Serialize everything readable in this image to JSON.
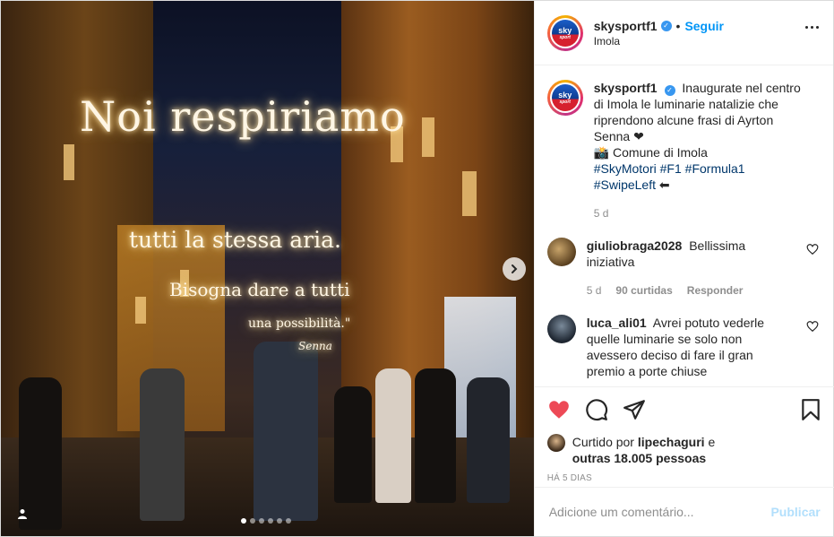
{
  "post": {
    "author": "skysportf1",
    "location": "Imola",
    "follow_label": "Seguir",
    "separator": "•",
    "verified_mark": "✓",
    "logo_text_top": "sky",
    "logo_text_bottom": "sport"
  },
  "photo": {
    "lines": [
      "Noi respiriamo",
      "tutti la stessa aria.",
      "Bisogna dare a tutti",
      "una possibilità.\"",
      "Senna"
    ],
    "carousel_total": 6,
    "carousel_active": 1
  },
  "caption": {
    "author": "skysportf1",
    "text": "Inaugurate nel centro di Imola le luminarie natalizie che riprendono alcune frasi di Ayrton Senna ❤",
    "line2": "📸 Comune di Imola",
    "hashtags": [
      "#SkyMotori",
      "#F1",
      "#Formula1",
      "#SwipeLeft"
    ],
    "arrow": "⬅",
    "age": "5 d"
  },
  "comments": [
    {
      "author": "giuliobraga2028",
      "text": "Bellissima iniziativa",
      "age": "5 d",
      "likes": "90 curtidas",
      "reply": "Responder"
    },
    {
      "author": "luca_ali01",
      "text": "Avrei potuto vederle quelle luminarie se solo non avessero deciso di fare il gran premio a porte chiuse"
    }
  ],
  "likes": {
    "prefix": "Curtido por",
    "user": "lipechaguri",
    "conj": "e",
    "others": "outras 18.005 pessoas"
  },
  "timestamp": "HÁ 5 DIAS",
  "add_comment": {
    "placeholder": "Adicione um comentário...",
    "publish": "Publicar"
  },
  "colors": {
    "link_blue": "#0095f6",
    "hashtag": "#00376b",
    "like_red": "#ed4956",
    "muted": "#8e8e8e"
  },
  "icons": [
    "chevron-right-icon",
    "user-tag-icon",
    "more-icon",
    "heart-icon",
    "comment-icon",
    "share-icon",
    "bookmark-icon"
  ]
}
